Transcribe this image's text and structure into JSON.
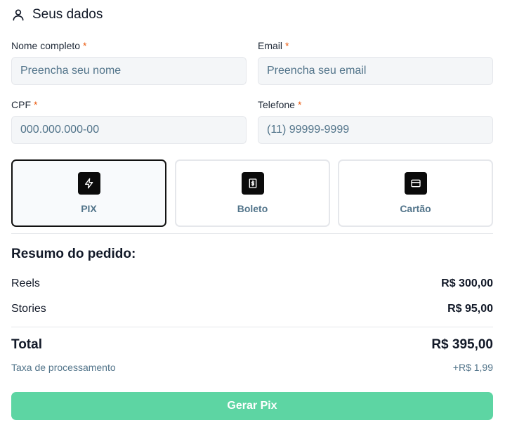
{
  "header": {
    "title": "Seus dados",
    "icon": "user-icon"
  },
  "form": {
    "full_name": {
      "label": "Nome completo",
      "required": "*",
      "placeholder": "Preencha seu nome",
      "value": ""
    },
    "email": {
      "label": "Email",
      "required": "*",
      "placeholder": "Preencha seu email",
      "value": ""
    },
    "cpf": {
      "label": "CPF",
      "required": "*",
      "placeholder": "000.000.000-00",
      "value": ""
    },
    "phone": {
      "label": "Telefone",
      "required": "*",
      "placeholder": "(11) 99999-9999",
      "value": ""
    }
  },
  "payment_methods": [
    {
      "label": "PIX",
      "icon": "lightning-icon",
      "selected": true
    },
    {
      "label": "Boleto",
      "icon": "dollar-receipt-icon",
      "selected": false
    },
    {
      "label": "Cartão",
      "icon": "credit-card-icon",
      "selected": false
    }
  ],
  "summary": {
    "title": "Resumo do pedido:",
    "items": [
      {
        "name": "Reels",
        "price": "R$ 300,00"
      },
      {
        "name": "Stories",
        "price": "R$ 95,00"
      }
    ],
    "total_label": "Total",
    "total_value": "R$ 395,00",
    "fee_label": "Taxa de processamento",
    "fee_value": "+R$ 1,99"
  },
  "submit": {
    "label": "Gerar Pix"
  },
  "colors": {
    "accent": "#5dd5a3",
    "required": "#ea580c",
    "muted_text": "#52748a",
    "input_bg": "#f4f6f8"
  }
}
